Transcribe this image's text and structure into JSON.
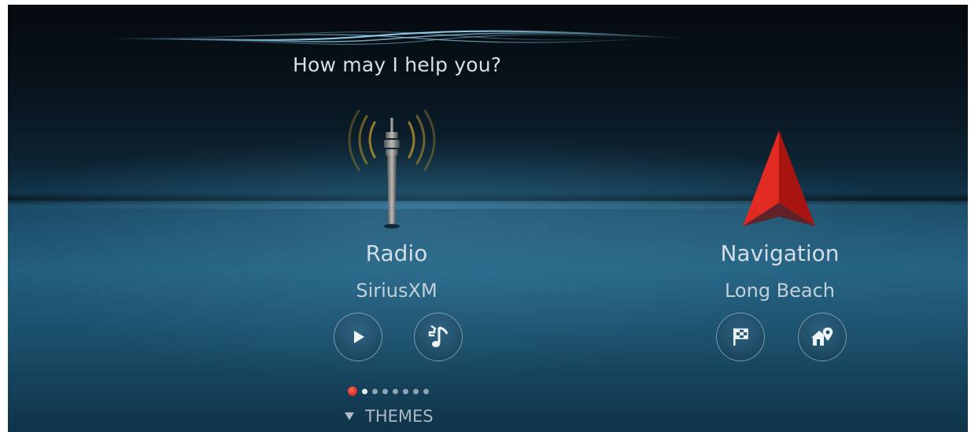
{
  "assistant": {
    "prompt": "How may I help you?"
  },
  "tiles": [
    {
      "title": "Radio",
      "subtitle": "SiriusXM",
      "icon": "radio-tower-icon",
      "buttons": [
        {
          "icon": "play-icon"
        },
        {
          "icon": "music-note-icon"
        }
      ]
    },
    {
      "title": "Navigation",
      "subtitle": "Long Beach",
      "icon": "navigation-arrow-icon",
      "buttons": [
        {
          "icon": "destination-flag-icon"
        },
        {
          "icon": "home-pin-icon"
        }
      ]
    }
  ],
  "pager": {
    "count": 8,
    "active_index": 0
  },
  "themes": {
    "label": "THEMES"
  },
  "colors": {
    "accent_red": "#c4140e",
    "text": "#d3dde4",
    "wave": "#7fd3f5"
  }
}
